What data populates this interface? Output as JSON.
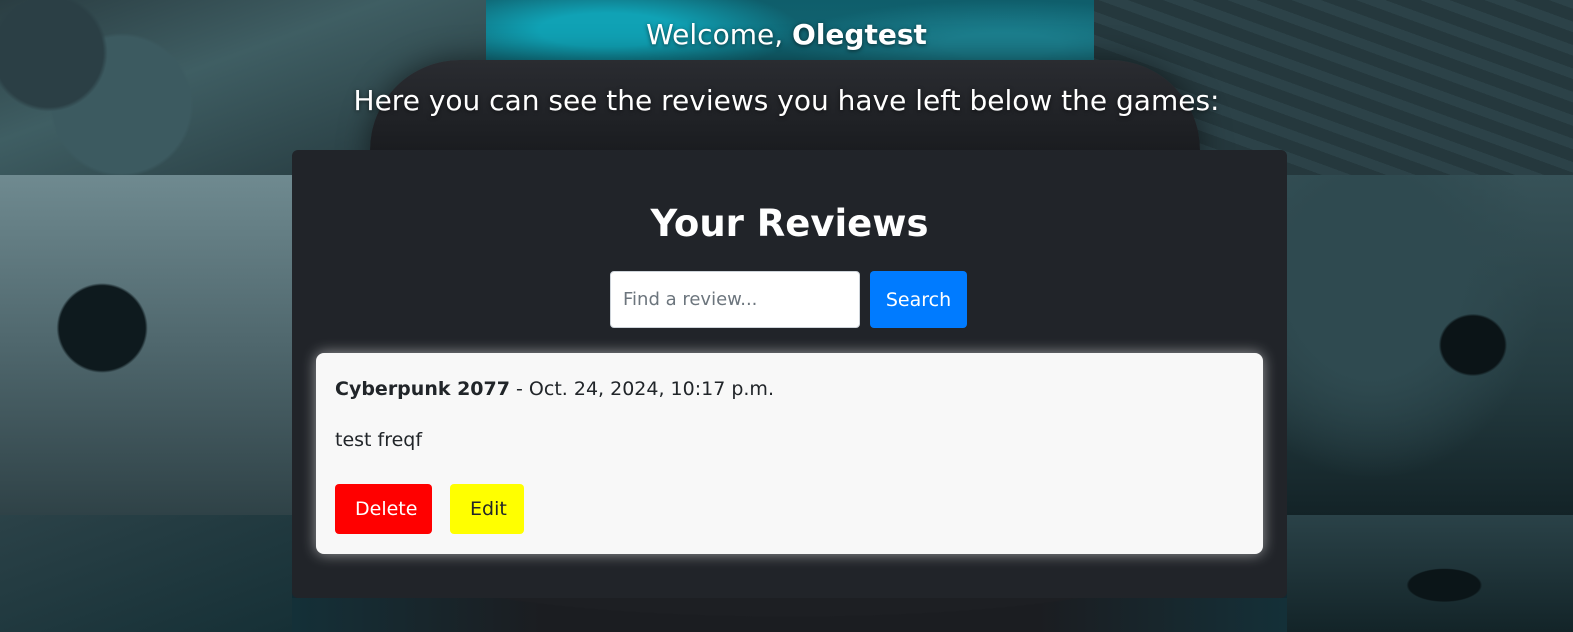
{
  "header": {
    "welcome_prefix": "Welcome, ",
    "username": "Olegtest",
    "subtitle": "Here you can see the reviews you have left below the games:"
  },
  "panel": {
    "title": "Your Reviews",
    "search": {
      "placeholder": "Find a review...",
      "value": "",
      "button_label": "Search"
    }
  },
  "reviews": [
    {
      "game": "Cyberpunk 2077",
      "separator": " - ",
      "date": "Oct. 24, 2024, 10:17 p.m.",
      "text": "test freqf",
      "delete_label": "Delete",
      "edit_label": "Edit"
    }
  ],
  "colors": {
    "panel_bg": "#212429",
    "search_button": "#007bff",
    "delete_button": "#ff0000",
    "edit_button": "#ffff00",
    "card_bg": "#f8f8f8"
  }
}
